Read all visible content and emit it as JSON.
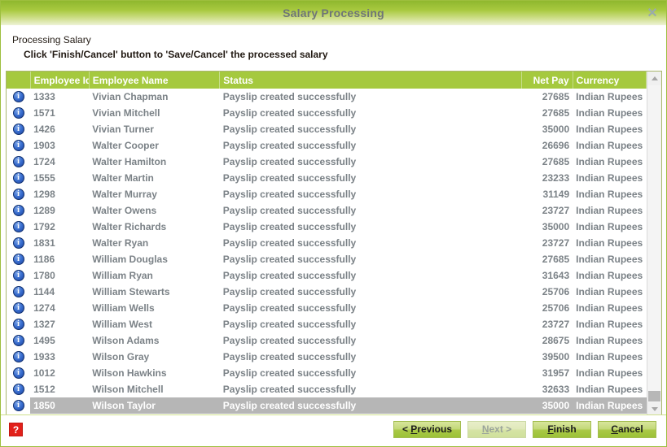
{
  "window": {
    "title": "Salary Processing",
    "close_label": "✕"
  },
  "instructions": {
    "heading": "Processing Salary",
    "detail": "Click 'Finish/Cancel' button to 'Save/Cancel' the processed salary"
  },
  "grid": {
    "columns": [
      {
        "key": "icon",
        "label": ""
      },
      {
        "key": "id",
        "label": "Employee Id"
      },
      {
        "key": "name",
        "label": "Employee Name"
      },
      {
        "key": "status",
        "label": "Status"
      },
      {
        "key": "net_pay",
        "label": "Net Pay"
      },
      {
        "key": "currency",
        "label": "Currency"
      }
    ],
    "row_icon": "i",
    "rows": [
      {
        "id": "1333",
        "name": "Vivian Chapman",
        "status": "Payslip created successfully",
        "net_pay": "27685",
        "currency": "Indian Rupees",
        "selected": false
      },
      {
        "id": "1571",
        "name": "Vivian Mitchell",
        "status": "Payslip created successfully",
        "net_pay": "27685",
        "currency": "Indian Rupees",
        "selected": false
      },
      {
        "id": "1426",
        "name": "Vivian Turner",
        "status": "Payslip created successfully",
        "net_pay": "35000",
        "currency": "Indian Rupees",
        "selected": false
      },
      {
        "id": "1903",
        "name": "Walter Cooper",
        "status": "Payslip created successfully",
        "net_pay": "26696",
        "currency": "Indian Rupees",
        "selected": false
      },
      {
        "id": "1724",
        "name": "Walter Hamilton",
        "status": "Payslip created successfully",
        "net_pay": "27685",
        "currency": "Indian Rupees",
        "selected": false
      },
      {
        "id": "1555",
        "name": "Walter Martin",
        "status": "Payslip created successfully",
        "net_pay": "23233",
        "currency": "Indian Rupees",
        "selected": false
      },
      {
        "id": "1298",
        "name": "Walter Murray",
        "status": "Payslip created successfully",
        "net_pay": "31149",
        "currency": "Indian Rupees",
        "selected": false
      },
      {
        "id": "1289",
        "name": "Walter Owens",
        "status": "Payslip created successfully",
        "net_pay": "23727",
        "currency": "Indian Rupees",
        "selected": false
      },
      {
        "id": "1792",
        "name": "Walter Richards",
        "status": "Payslip created successfully",
        "net_pay": "35000",
        "currency": "Indian Rupees",
        "selected": false
      },
      {
        "id": "1831",
        "name": "Walter Ryan",
        "status": "Payslip created successfully",
        "net_pay": "23727",
        "currency": "Indian Rupees",
        "selected": false
      },
      {
        "id": "1186",
        "name": "William Douglas",
        "status": "Payslip created successfully",
        "net_pay": "27685",
        "currency": "Indian Rupees",
        "selected": false
      },
      {
        "id": "1780",
        "name": "William Ryan",
        "status": "Payslip created successfully",
        "net_pay": "31643",
        "currency": "Indian Rupees",
        "selected": false
      },
      {
        "id": "1144",
        "name": "William Stewarts",
        "status": "Payslip created successfully",
        "net_pay": "25706",
        "currency": "Indian Rupees",
        "selected": false
      },
      {
        "id": "1274",
        "name": "William Wells",
        "status": "Payslip created successfully",
        "net_pay": "25706",
        "currency": "Indian Rupees",
        "selected": false
      },
      {
        "id": "1327",
        "name": "William West",
        "status": "Payslip created successfully",
        "net_pay": "23727",
        "currency": "Indian Rupees",
        "selected": false
      },
      {
        "id": "1495",
        "name": "Wilson Adams",
        "status": "Payslip created successfully",
        "net_pay": "28675",
        "currency": "Indian Rupees",
        "selected": false
      },
      {
        "id": "1933",
        "name": "Wilson Gray",
        "status": "Payslip created successfully",
        "net_pay": "39500",
        "currency": "Indian Rupees",
        "selected": false
      },
      {
        "id": "1012",
        "name": "Wilson Hawkins",
        "status": "Payslip created successfully",
        "net_pay": "31957",
        "currency": "Indian Rupees",
        "selected": false
      },
      {
        "id": "1512",
        "name": "Wilson Mitchell",
        "status": "Payslip created successfully",
        "net_pay": "32633",
        "currency": "Indian Rupees",
        "selected": false
      },
      {
        "id": "1850",
        "name": "Wilson Taylor",
        "status": "Payslip created successfully",
        "net_pay": "35000",
        "currency": "Indian Rupees",
        "selected": true
      }
    ]
  },
  "scrollbar": {
    "up_arrow": "▲",
    "down_arrow": "▼"
  },
  "footer": {
    "help_label": "?",
    "buttons": [
      {
        "id": "previous",
        "prefix": "< ",
        "mnemonic": "P",
        "suffix": "revious",
        "disabled": false
      },
      {
        "id": "next",
        "prefix": "",
        "mnemonic": "N",
        "suffix": "ext >",
        "disabled": true
      },
      {
        "id": "finish",
        "prefix": "",
        "mnemonic": "F",
        "suffix": "inish",
        "disabled": false
      },
      {
        "id": "cancel",
        "prefix": "",
        "mnemonic": "C",
        "suffix": "ancel",
        "disabled": false
      }
    ]
  },
  "colors": {
    "title_gradient_top": "#8fb72e",
    "header_green": "#a5c93e",
    "border_green": "#9dbf3e",
    "row_text": "#7b8287",
    "selected_row_bg": "#b6b6b6",
    "help_red": "#e2201a",
    "info_icon_blue": "#3a6fd0"
  }
}
